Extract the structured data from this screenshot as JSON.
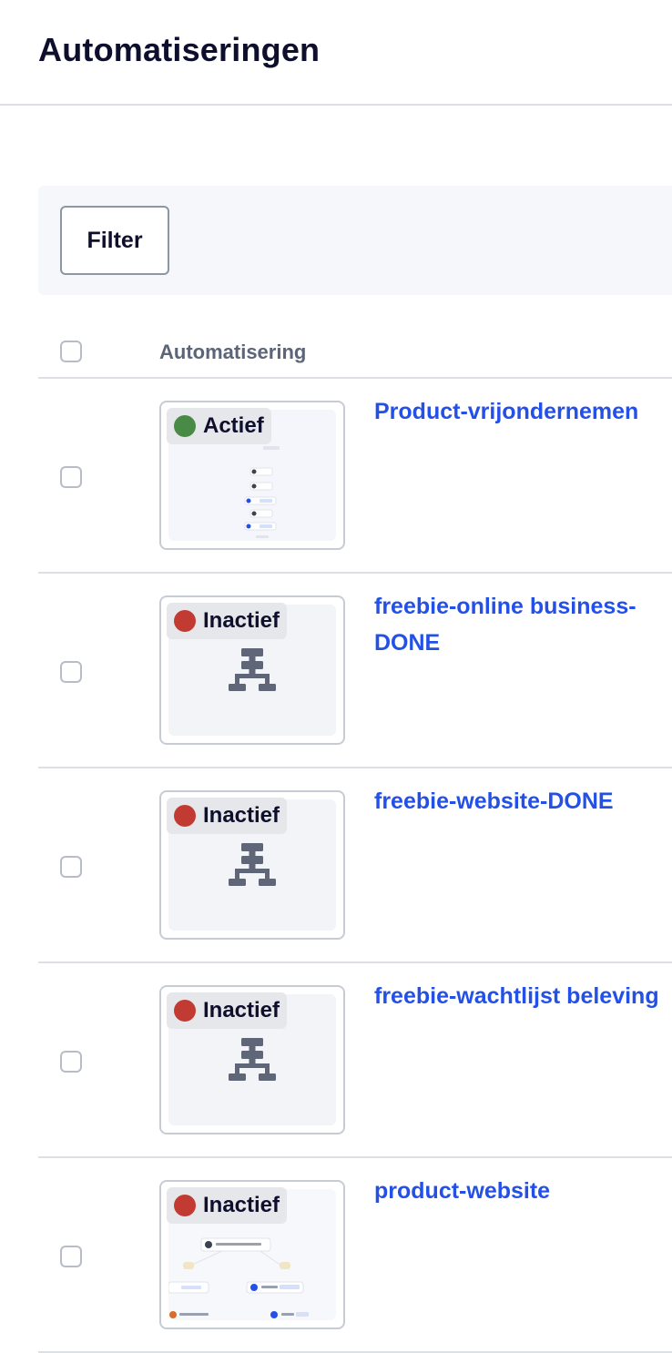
{
  "page": {
    "title": "Automatiseringen"
  },
  "filter": {
    "label": "Filter"
  },
  "table": {
    "column_label": "Automatisering"
  },
  "colors": {
    "active": "#4a8a47",
    "inactive": "#c13b33",
    "link": "#2350e6"
  },
  "rows": [
    {
      "status": "Actief",
      "status_color": "#4a8a47",
      "title": "Product-vrijondernemen",
      "thumbnail": "workflow-preview"
    },
    {
      "status": "Inactief",
      "status_color": "#c13b33",
      "title": "freebie-online business-DONE",
      "thumbnail": "flow-icon"
    },
    {
      "status": "Inactief",
      "status_color": "#c13b33",
      "title": "freebie-website-DONE",
      "thumbnail": "flow-icon"
    },
    {
      "status": "Inactief",
      "status_color": "#c13b33",
      "title": "freebie-wachtlijst beleving",
      "thumbnail": "flow-icon"
    },
    {
      "status": "Inactief",
      "status_color": "#c13b33",
      "title": "product-website",
      "thumbnail": "workflow-preview"
    }
  ]
}
